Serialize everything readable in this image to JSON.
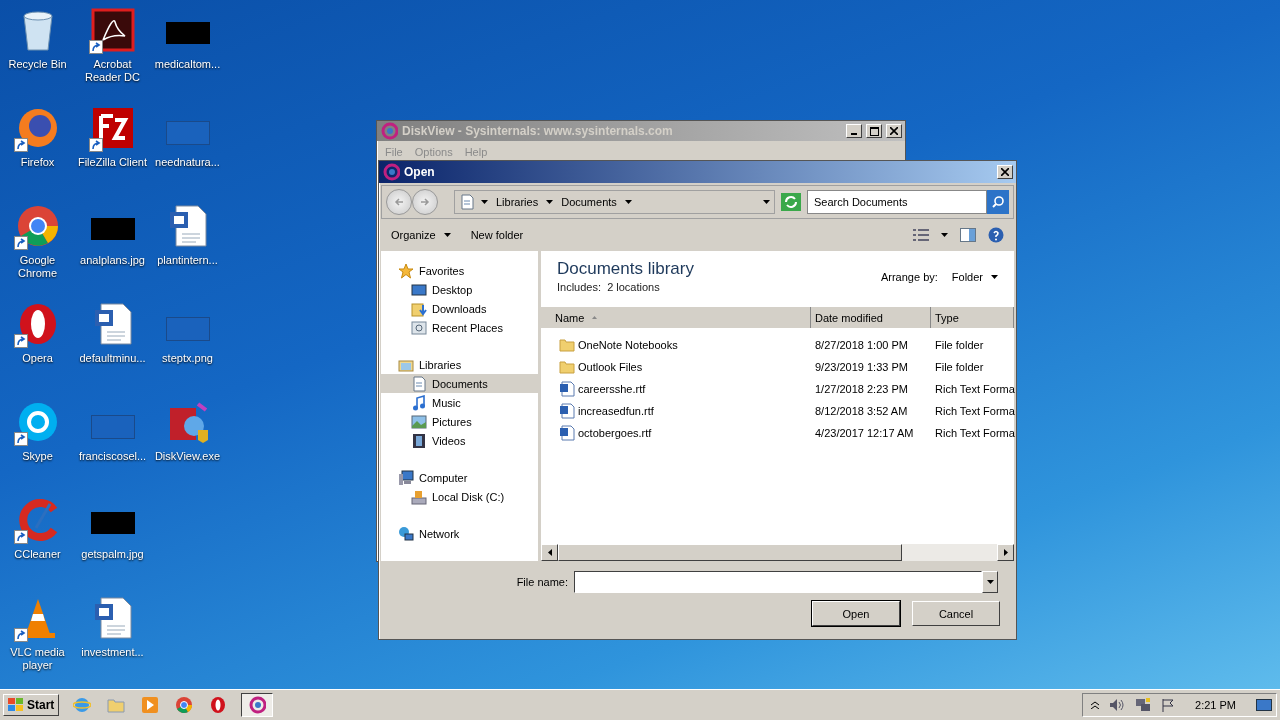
{
  "desktop": {
    "icons": [
      {
        "label": "Recycle Bin",
        "kind": "bin",
        "shortcut": false
      },
      {
        "label": "Firefox",
        "kind": "fox",
        "shortcut": true
      },
      {
        "label": "Google Chrome",
        "kind": "chrome",
        "shortcut": true
      },
      {
        "label": "Opera",
        "kind": "opera",
        "shortcut": true
      },
      {
        "label": "Skype",
        "kind": "chat",
        "shortcut": true
      },
      {
        "label": "CCleaner",
        "kind": "cleaner",
        "shortcut": true
      },
      {
        "label": "VLC media player",
        "kind": "cone",
        "shortcut": true
      },
      {
        "label": "Acrobat Reader DC",
        "kind": "pdf",
        "shortcut": true
      },
      {
        "label": "FileZilla Client",
        "kind": "ftp",
        "shortcut": true
      },
      {
        "label": "analplans.jpg",
        "kind": "dark-image",
        "shortcut": false
      },
      {
        "label": "defaultminu...",
        "kind": "document",
        "shortcut": false
      },
      {
        "label": "franciscosel...",
        "kind": "blank-image",
        "shortcut": false
      },
      {
        "label": "getspalm.jpg",
        "kind": "dark-image",
        "shortcut": false
      },
      {
        "label": "investment...",
        "kind": "document",
        "shortcut": false
      },
      {
        "label": "medicaltom...",
        "kind": "dark-image",
        "shortcut": false
      },
      {
        "label": "neednatura...",
        "kind": "blank-image",
        "shortcut": false
      },
      {
        "label": "plantintern...",
        "kind": "document",
        "shortcut": false
      },
      {
        "label": "steptx.png",
        "kind": "blank-image",
        "shortcut": false
      },
      {
        "label": "DiskView.exe",
        "kind": "app",
        "shortcut": false
      }
    ]
  },
  "back_window": {
    "title": "DiskView - Sysinternals: www.sysinternals.com",
    "active": false,
    "menu": [
      "File",
      "Options",
      "Help"
    ]
  },
  "dialog": {
    "title": "Open",
    "active": true,
    "breadcrumb": [
      "Libraries",
      "Documents"
    ],
    "search": {
      "placeholder": "Search Documents"
    },
    "toolbar": [
      "Organize",
      "New folder"
    ],
    "navigation": [
      {
        "label": "Favorites",
        "kind": "star",
        "selected": false,
        "children": [
          {
            "label": "Desktop",
            "kind": "desktop",
            "selected": false
          },
          {
            "label": "Downloads",
            "kind": "downloads",
            "selected": false
          },
          {
            "label": "Recent Places",
            "kind": "recent",
            "selected": false
          }
        ]
      },
      {
        "label": "Libraries",
        "kind": "library",
        "selected": false,
        "children": [
          {
            "label": "Documents",
            "kind": "documents",
            "selected": true
          },
          {
            "label": "Music",
            "kind": "music",
            "selected": false
          },
          {
            "label": "Pictures",
            "kind": "pictures",
            "selected": false
          },
          {
            "label": "Videos",
            "kind": "videos",
            "selected": false
          }
        ]
      },
      {
        "label": "Computer",
        "kind": "computer",
        "selected": false,
        "children": [
          {
            "label": "Local Disk (C:)",
            "kind": "disk",
            "selected": false
          }
        ]
      },
      {
        "label": "Network",
        "kind": "network",
        "selected": false
      }
    ],
    "library_title": "Documents library",
    "includes": "Includes:  2 locations",
    "arrange_label": "Arrange by:",
    "arrange_value": "Folder",
    "columns": [
      "Name",
      "Date modified",
      "Type"
    ],
    "rows": [
      {
        "kind": "folder",
        "name": "OneNote Notebooks",
        "date": "8/27/2018 1:00 PM",
        "type": "File folder"
      },
      {
        "kind": "folder",
        "name": "Outlook Files",
        "date": "9/23/2019 1:33 PM",
        "type": "File folder"
      },
      {
        "kind": "document",
        "name": "careersshe.rtf",
        "date": "1/27/2018 2:23 PM",
        "type": "Rich Text Forma"
      },
      {
        "kind": "document",
        "name": "increasedfun.rtf",
        "date": "8/12/2018 3:52 AM",
        "type": "Rich Text Forma"
      },
      {
        "kind": "document",
        "name": "octobergoes.rtf",
        "date": "4/23/2017 12:17 AM",
        "type": "Rich Text Forma"
      }
    ],
    "filename_label": "File name:",
    "buttons": [
      "Open",
      "Cancel"
    ]
  },
  "taskbar": {
    "start": "Start",
    "items": [
      {
        "kind": "ie",
        "selected": false
      },
      {
        "kind": "explorer",
        "selected": false
      },
      {
        "kind": "media",
        "selected": false
      },
      {
        "kind": "chrome",
        "selected": false
      },
      {
        "kind": "opera",
        "selected": false
      },
      {
        "kind": "app",
        "selected": true
      }
    ],
    "clock": "2:21 PM"
  }
}
